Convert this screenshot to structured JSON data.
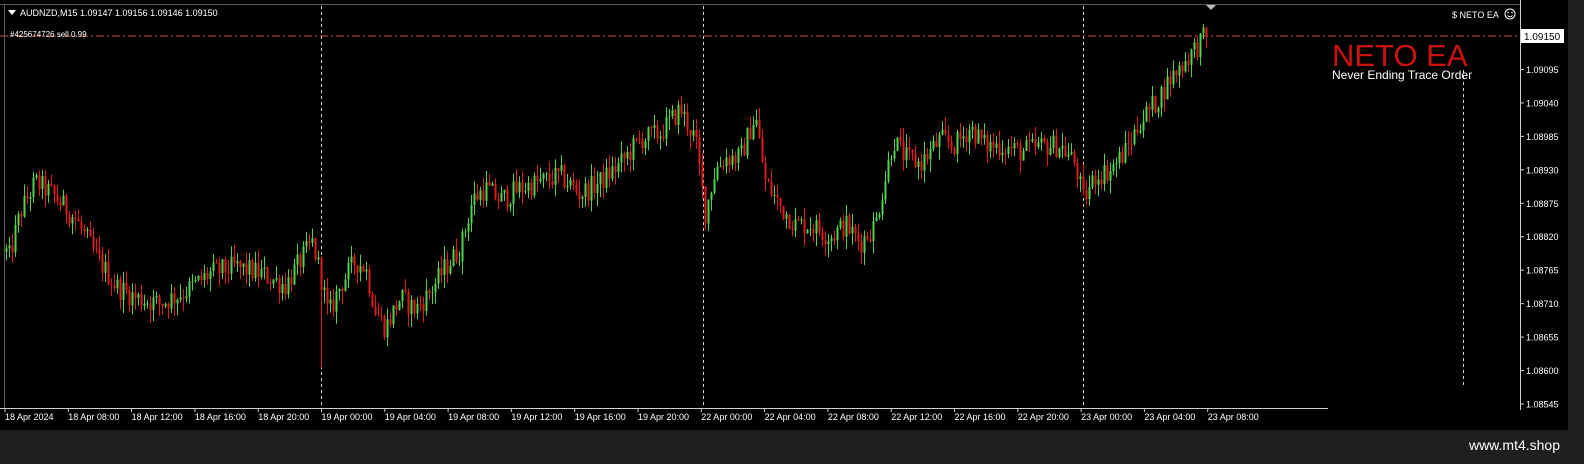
{
  "header": {
    "symbol_line": "AUDNZD,M15  1.09147 1.09156 1.09146 1.09150",
    "order_label": "#425674726 sell 0.99",
    "ea_label": "$ NETO EA",
    "current_price": "1.09150"
  },
  "branding": {
    "title": "NETO EA",
    "subtitle": "Never Ending Trace Order",
    "site": "www.mt4.shop"
  },
  "colors": {
    "background": "#000000",
    "bull": "#4fd24f",
    "bear": "#e01a1a",
    "price_line": "#c85050",
    "brand": "#cc1111"
  },
  "chart_data": {
    "type": "candlestick",
    "symbol": "AUDNZD",
    "timeframe": "M15",
    "ylim": [
      1.0852,
      1.092
    ],
    "y_ticks": [
      "1.09150",
      "1.09095",
      "1.09040",
      "1.08985",
      "1.08930",
      "1.08875",
      "1.08820",
      "1.08765",
      "1.08710",
      "1.08655",
      "1.08600",
      "1.08545"
    ],
    "x_ticks": [
      "18 Apr 2024",
      "18 Apr 08:00",
      "18 Apr 12:00",
      "18 Apr 16:00",
      "18 Apr 20:00",
      "19 Apr 00:00",
      "19 Apr 04:00",
      "19 Apr 08:00",
      "19 Apr 12:00",
      "19 Apr 16:00",
      "19 Apr 20:00",
      "22 Apr 00:00",
      "22 Apr 04:00",
      "22 Apr 08:00",
      "22 Apr 12:00",
      "22 Apr 16:00",
      "22 Apr 20:00",
      "23 Apr 00:00",
      "23 Apr 04:00",
      "23 Apr 08:00"
    ],
    "period_separators": [
      "19 Apr 00:00",
      "22 Apr 00:00",
      "23 Apr 00:00"
    ],
    "current_price": 1.0915,
    "last_bar": {
      "open": 1.09147,
      "high": 1.09156,
      "low": 1.09146,
      "close": 1.0915
    },
    "close_path": [
      [
        0,
        1.0884
      ],
      [
        8,
        1.0878
      ],
      [
        20,
        1.0886
      ],
      [
        35,
        1.0891
      ],
      [
        52,
        1.0889
      ],
      [
        75,
        1.0885
      ],
      [
        95,
        1.0879
      ],
      [
        115,
        1.0874
      ],
      [
        135,
        1.0872
      ],
      [
        160,
        1.0871
      ],
      [
        185,
        1.0873
      ],
      [
        210,
        1.0876
      ],
      [
        235,
        1.0877
      ],
      [
        260,
        1.0876
      ],
      [
        285,
        1.0874
      ],
      [
        300,
        1.0878
      ],
      [
        312,
        1.0881
      ],
      [
        320,
        1.0876
      ],
      [
        328,
        1.0869
      ],
      [
        340,
        1.0874
      ],
      [
        355,
        1.0878
      ],
      [
        365,
        1.0877
      ],
      [
        375,
        1.087
      ],
      [
        385,
        1.0867
      ],
      [
        400,
        1.0872
      ],
      [
        415,
        1.087
      ],
      [
        430,
        1.0873
      ],
      [
        445,
        1.0877
      ],
      [
        460,
        1.088
      ],
      [
        472,
        1.0888
      ],
      [
        485,
        1.089
      ],
      [
        500,
        1.0888
      ],
      [
        520,
        1.089
      ],
      [
        540,
        1.0891
      ],
      [
        560,
        1.0892
      ],
      [
        580,
        1.0889
      ],
      [
        600,
        1.0891
      ],
      [
        620,
        1.0894
      ],
      [
        640,
        1.0898
      ],
      [
        660,
        1.0899
      ],
      [
        680,
        1.0903
      ],
      [
        695,
        1.0898
      ],
      [
        705,
        1.0886
      ],
      [
        715,
        1.0893
      ],
      [
        725,
        1.0895
      ],
      [
        740,
        1.0895
      ],
      [
        755,
        1.0902
      ],
      [
        765,
        1.0891
      ],
      [
        780,
        1.0887
      ],
      [
        795,
        1.0884
      ],
      [
        810,
        1.0884
      ],
      [
        830,
        1.0882
      ],
      [
        845,
        1.0884
      ],
      [
        860,
        1.0881
      ],
      [
        875,
        1.0884
      ],
      [
        893,
        1.0898
      ],
      [
        905,
        1.0895
      ],
      [
        920,
        1.0894
      ],
      [
        940,
        1.0898
      ],
      [
        955,
        1.0897
      ],
      [
        970,
        1.09
      ],
      [
        985,
        1.0897
      ],
      [
        1000,
        1.0897
      ],
      [
        1020,
        1.0896
      ],
      [
        1045,
        1.0897
      ],
      [
        1060,
        1.0897
      ],
      [
        1075,
        1.0894
      ],
      [
        1083,
        1.0888
      ],
      [
        1095,
        1.0892
      ],
      [
        1110,
        1.0893
      ],
      [
        1125,
        1.0896
      ],
      [
        1140,
        1.0901
      ],
      [
        1155,
        1.0904
      ],
      [
        1170,
        1.0908
      ],
      [
        1185,
        1.0911
      ],
      [
        1195,
        1.0913
      ],
      [
        1205,
        1.0915
      ]
    ]
  }
}
